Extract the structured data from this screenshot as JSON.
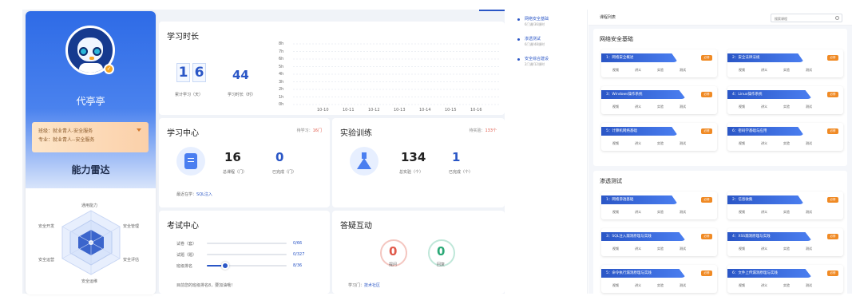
{
  "profile": {
    "name": "代亭亭",
    "class_line": "班级：就业青人-安全服务",
    "major_line": "专业：就业青人--安全服务",
    "radar_title": "能力雷达",
    "radar_labels": [
      "通用能力",
      "安全管理",
      "安全评估",
      "安全运维",
      "安全运营",
      "安全开发"
    ]
  },
  "study_time": {
    "title": "学习时长",
    "days_digits": [
      "1",
      "6"
    ],
    "days_label": "累计学习（天）",
    "hours_value": "44",
    "hours_label": "学习时长（时）",
    "chart_y_labels": [
      "8h",
      "7h",
      "6h",
      "5h",
      "4h",
      "3h",
      "2h",
      "1h",
      "0h"
    ],
    "chart_x_labels": [
      "10-10",
      "10-11",
      "10-12",
      "10-13",
      "10-14",
      "10-15",
      "10-16"
    ]
  },
  "learn_center": {
    "title": "学习中心",
    "hint_prefix": "待学习：",
    "hint_value": "16门",
    "total": "16",
    "total_label": "总课程（门）",
    "done": "0",
    "done_label": "已完成（门）",
    "recent_prefix": "最近在学：",
    "recent_course": "SQL注入"
  },
  "train": {
    "title": "实验训练",
    "hint_prefix": "待实验：",
    "hint_value": "133个",
    "total": "134",
    "total_label": "总实验（个）",
    "done": "1",
    "done_label": "已完成（个）"
  },
  "exam": {
    "title": "考试中心",
    "rows": [
      {
        "label": "试卷（套）",
        "value": "0/66",
        "ratio": 0
      },
      {
        "label": "试题（题）",
        "value": "0/327",
        "ratio": 0
      },
      {
        "label": "班级排名",
        "value": "8/36",
        "ratio": 0.22
      }
    ],
    "footer": "目前您的班级排名8，要加油哦！"
  },
  "qa": {
    "title": "答疑互动",
    "asked": "0",
    "asked_label": "提问",
    "replied": "0",
    "replied_label": "回复",
    "footer_prefix": "学习门：",
    "footer_link": "技术社区"
  },
  "course_nav": [
    {
      "title": "网络安全基础",
      "sub": "6门课/36课时"
    },
    {
      "title": "渗透测试",
      "sub": "6门课/48课时"
    },
    {
      "title": "安全综合建设",
      "sub": "2门课/12课时"
    }
  ],
  "course_list": {
    "title": "课程列表",
    "search_placeholder": "搜索课程",
    "actions": [
      "视频",
      "讲义",
      "实验",
      "测试"
    ],
    "badge": "必修",
    "sections": [
      {
        "title": "网络安全基础",
        "courses": [
          "1：网络安全概述",
          "2：安全法律法规",
          "3：Windows操作系统",
          "4：Linux操作系统",
          "5：计算机网络基础",
          "6：密码学基础与应用"
        ]
      },
      {
        "title": "渗透测试",
        "courses": [
          "1：网络渗透基础",
          "2：信息收集",
          "3：SQL注入漏洞原理与实践",
          "4：XSS漏洞原理与实践",
          "5：命令执行漏洞原理与实践",
          "6：文件上传漏洞原理与实践"
        ]
      }
    ]
  },
  "colors": {
    "primary": "#2a56c6",
    "accent_orange": "#f08a24",
    "warning_red": "#e05a4b"
  }
}
